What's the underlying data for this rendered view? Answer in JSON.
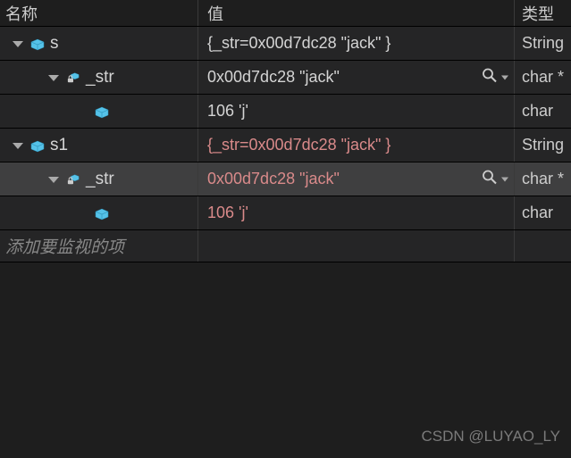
{
  "headers": {
    "name": "名称",
    "value": "值",
    "type": "类型"
  },
  "add_watch_placeholder": "添加要监视的项",
  "watermark": "CSDN @LUYAO_LY",
  "rows": [
    {
      "indent": 0,
      "expander": true,
      "icon": "cube",
      "name": "s",
      "value": "{_str=0x00d7dc28 \"jack\" }",
      "type": "String",
      "stale": false,
      "magnify": false,
      "selected": false
    },
    {
      "indent": 1,
      "expander": true,
      "icon": "lock-cube",
      "name": "_str",
      "value": "0x00d7dc28 \"jack\"",
      "type": "char *",
      "stale": false,
      "magnify": true,
      "selected": false
    },
    {
      "indent": 2,
      "expander": false,
      "icon": "cube",
      "name": "",
      "value": "106 'j'",
      "type": "char",
      "stale": false,
      "magnify": false,
      "selected": false
    },
    {
      "indent": 0,
      "expander": true,
      "icon": "cube",
      "name": "s1",
      "value": "{_str=0x00d7dc28 \"jack\" }",
      "type": "String",
      "stale": true,
      "magnify": false,
      "selected": false
    },
    {
      "indent": 1,
      "expander": true,
      "icon": "lock-cube",
      "name": "_str",
      "value": "0x00d7dc28 \"jack\"",
      "type": "char *",
      "stale": true,
      "magnify": true,
      "selected": true
    },
    {
      "indent": 2,
      "expander": false,
      "icon": "cube",
      "name": "",
      "value": "106 'j'",
      "type": "char",
      "stale": true,
      "magnify": false,
      "selected": false
    }
  ]
}
